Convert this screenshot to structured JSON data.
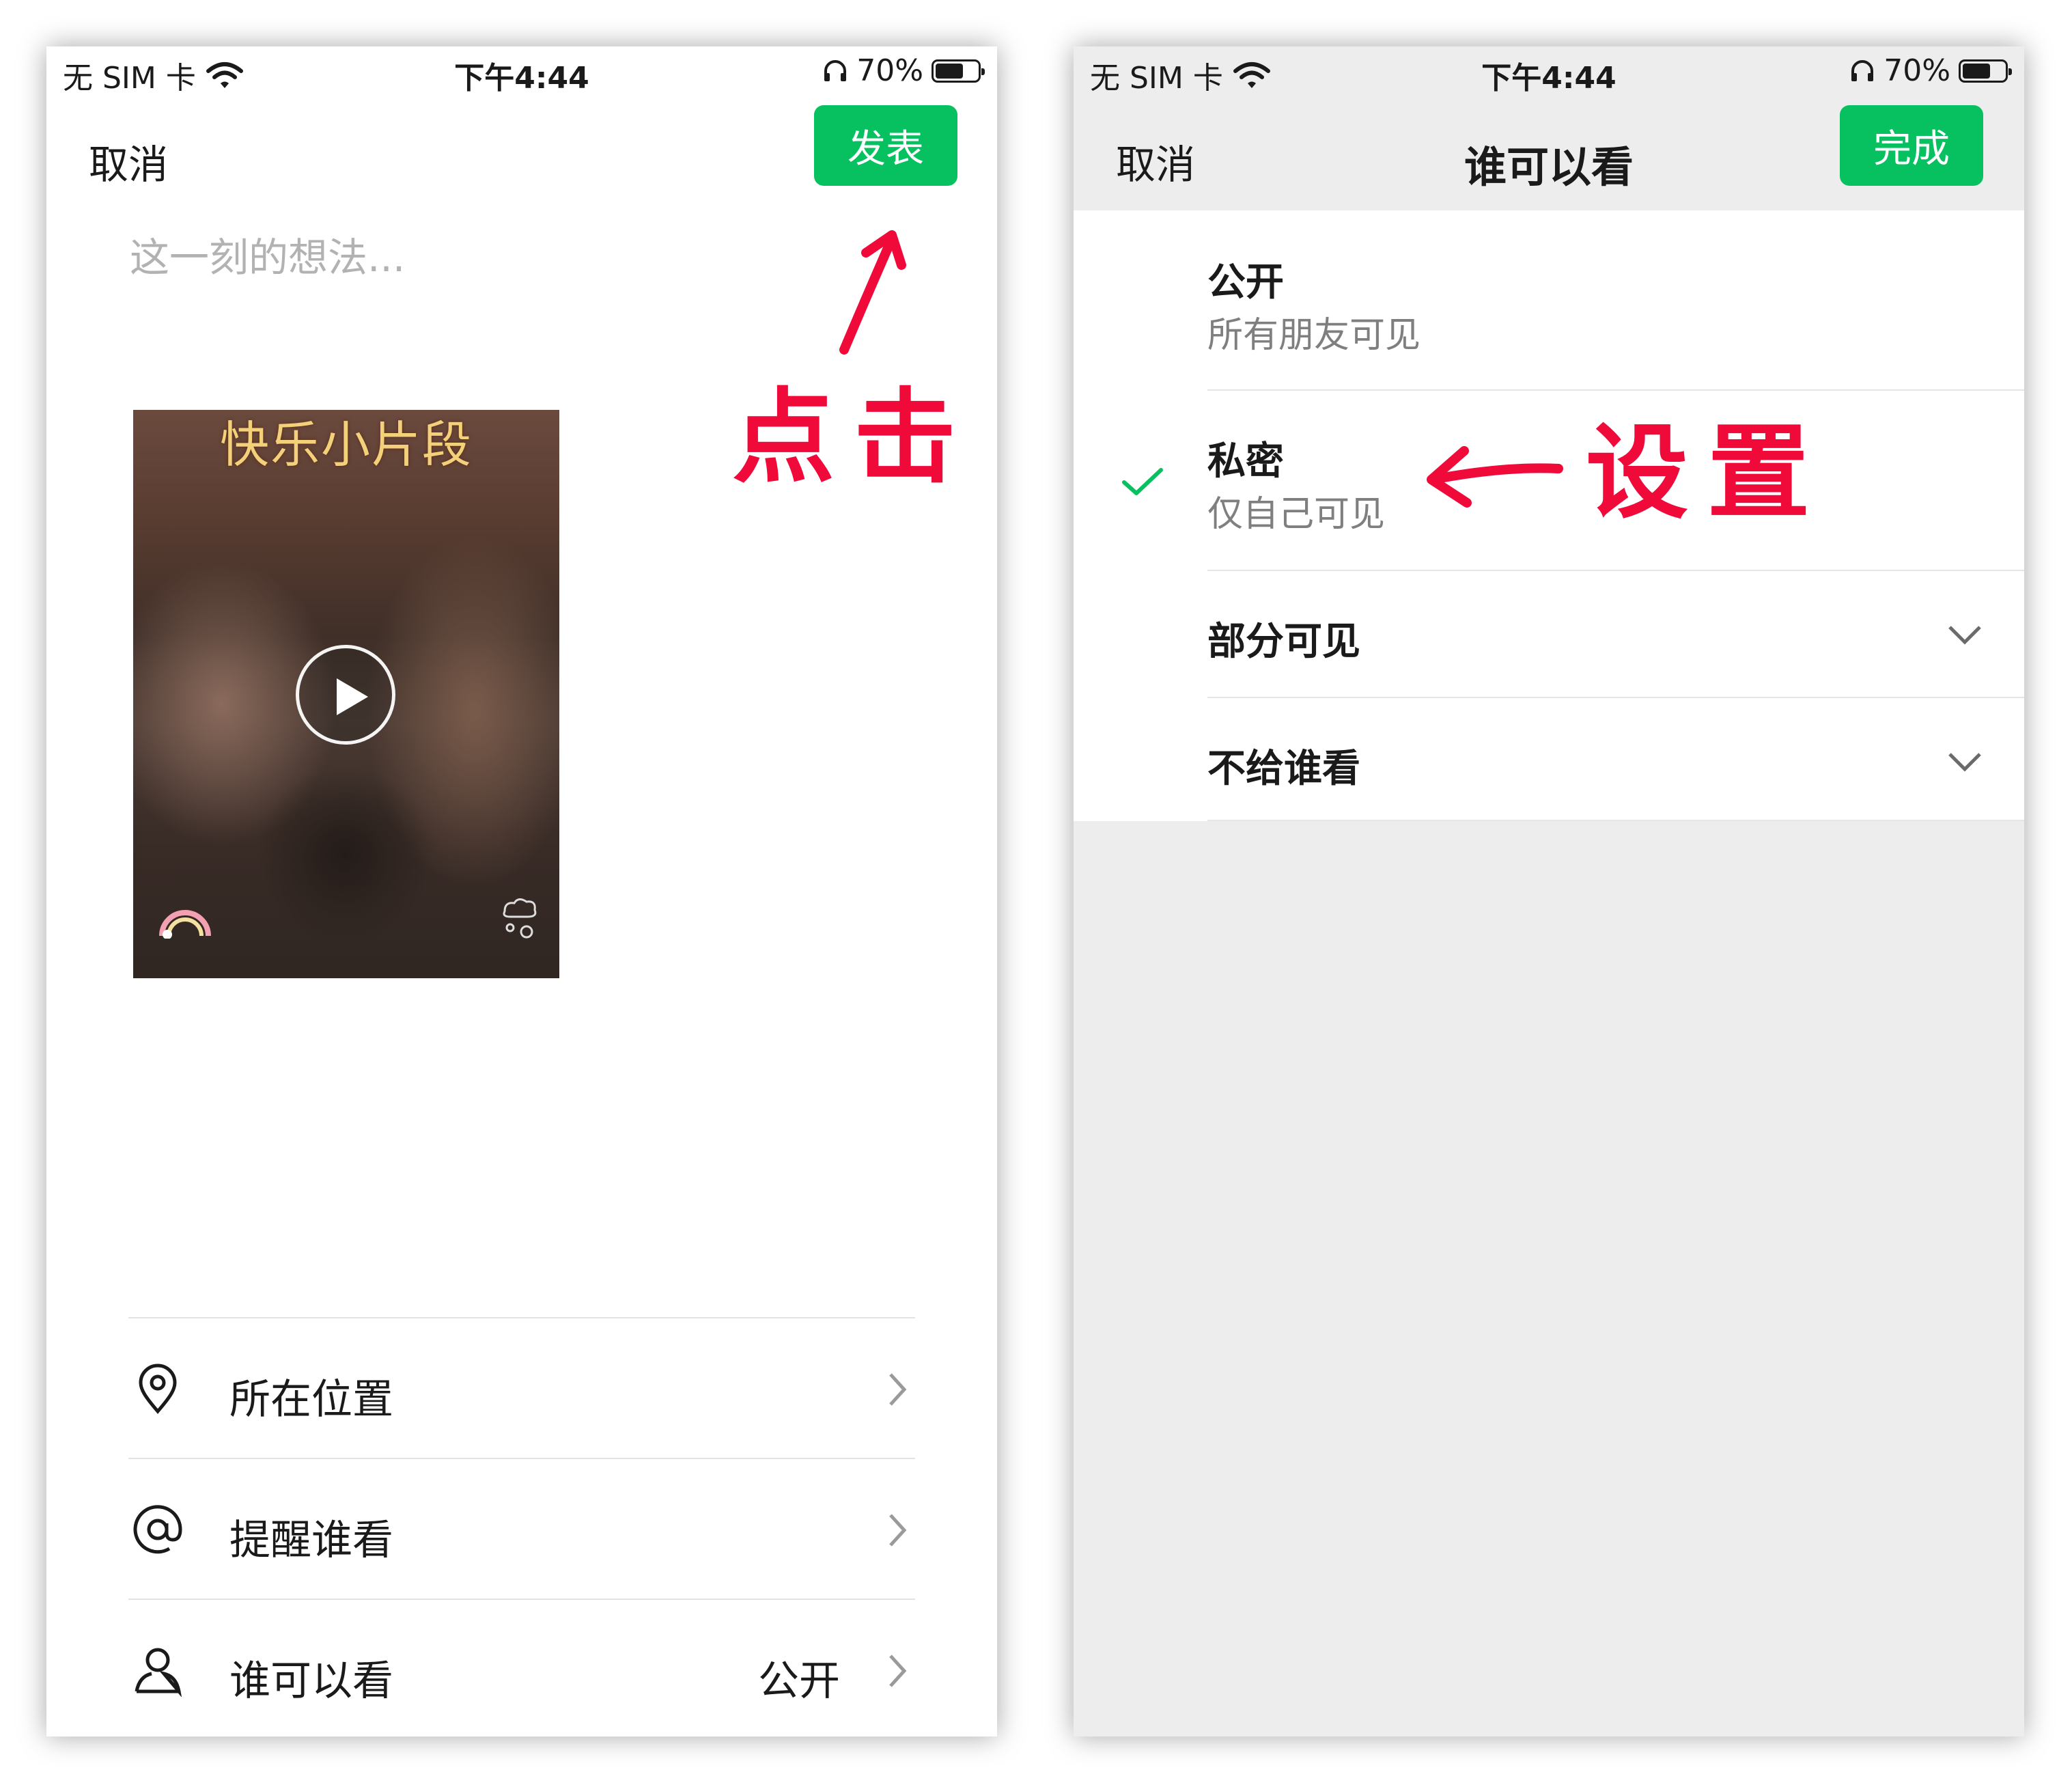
{
  "status_bar": {
    "carrier": "无 SIM 卡",
    "time": "下午4:44",
    "battery": "70%",
    "battery_level": 0.7
  },
  "left_screen": {
    "cancel": "取消",
    "publish": "发表",
    "placeholder": "这一刻的想法...",
    "video_caption": "快乐小片段",
    "menu": [
      {
        "icon": "location-pin-icon",
        "label": "所在位置",
        "value": ""
      },
      {
        "icon": "at-icon",
        "label": "提醒谁看",
        "value": ""
      },
      {
        "icon": "person-icon",
        "label": "谁可以看",
        "value": "公开"
      }
    ]
  },
  "right_screen": {
    "cancel": "取消",
    "title": "谁可以看",
    "done": "完成",
    "options": [
      {
        "title": "公开",
        "subtitle": "所有朋友可见",
        "selected": false
      },
      {
        "title": "私密",
        "subtitle": "仅自己可见",
        "selected": true
      },
      {
        "title": "部分可见",
        "subtitle": "",
        "selected": false,
        "expandable": true
      },
      {
        "title": "不给谁看",
        "subtitle": "",
        "selected": false,
        "expandable": true
      }
    ]
  },
  "annotations": {
    "click": "点击",
    "set": "设置",
    "color": "#f00a3a"
  },
  "colors": {
    "accent_green": "#07c160",
    "background_gray": "#ededed"
  }
}
